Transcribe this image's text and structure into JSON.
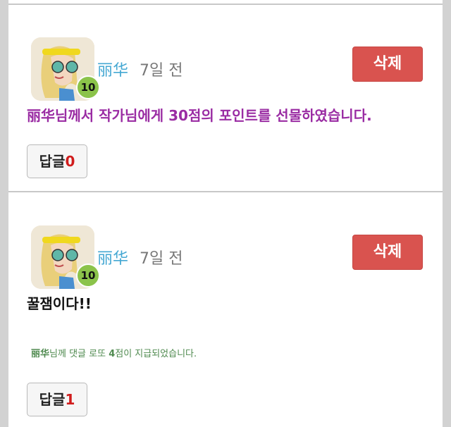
{
  "comments": [
    {
      "author": "丽华",
      "time": "7일 전",
      "level": "10",
      "delete_label": "삭제",
      "gift_message": {
        "author": "丽华",
        "before_points": "님께서 작가님에게 ",
        "points": "30",
        "after_points": "점의 포인트를 선물하였습니다."
      },
      "reply_label": "답글",
      "reply_count": "0"
    },
    {
      "author": "丽华",
      "time": "7일 전",
      "level": "10",
      "delete_label": "삭제",
      "text": "꿀잼이다!!",
      "point_notice": {
        "author": "丽华",
        "before_points": "님께 댓글 로또 ",
        "points": "4",
        "after_points": "점이 지급되었습니다."
      },
      "reply_label": "답글",
      "reply_count": "1"
    }
  ],
  "colors": {
    "author": "#45a8d3",
    "delete_button": "#d9534f",
    "gift_message": "#9a2ca3",
    "point_notice": "#4f8a4f",
    "reply_count": "#d01c1c",
    "level_badge": "#8bc34a"
  }
}
